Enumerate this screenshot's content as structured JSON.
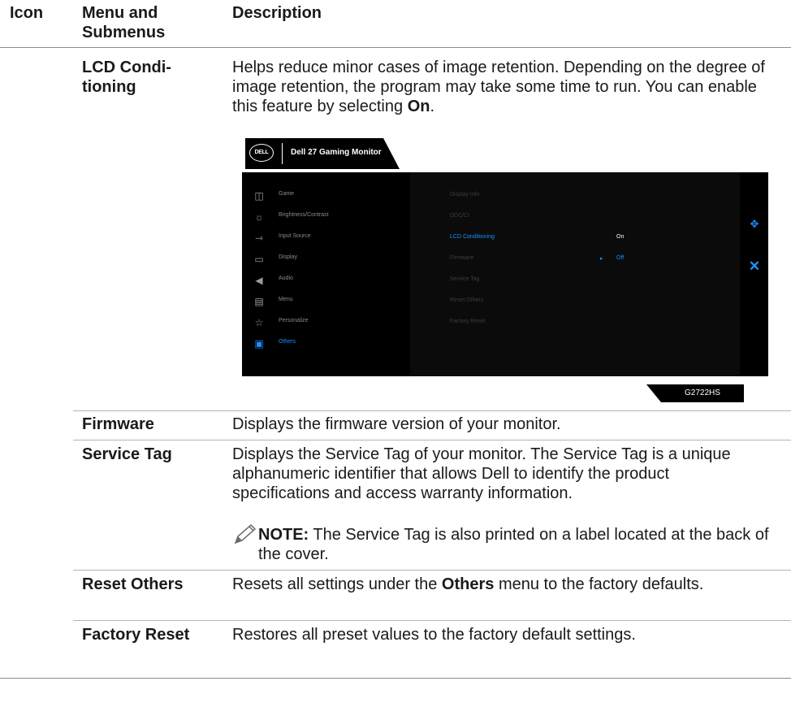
{
  "headers": {
    "icon": "Icon",
    "menu": "Menu and Submenus",
    "description": "Description"
  },
  "rows": {
    "lcd": {
      "term": "LCD Condi-tioning",
      "desc_text": "Helps reduce minor cases of image retention. Depending on the degree of image retention, the program may take some time to run. You can enable this feature by selecting ",
      "desc_bold": "On",
      "desc_end": "."
    },
    "firmware": {
      "term": "Firmware",
      "desc": "Displays the firmware version of your monitor."
    },
    "service_tag": {
      "term": "Service Tag",
      "desc": "Displays the Service Tag of your monitor. The Service Tag is a unique alphanumeric identifier that allows Dell to identify the product specifications and access warranty information.",
      "note_label": "NOTE:",
      "note_text": " The Service Tag is also printed on a label located at the back of the cover."
    },
    "reset_others": {
      "term": "Reset Others",
      "desc_start": "Resets all settings under the ",
      "desc_bold": "Others",
      "desc_end": " menu to the factory defaults."
    },
    "factory_reset": {
      "term": "Factory Reset",
      "desc": "Restores all preset values to the factory default settings."
    }
  },
  "osd": {
    "logo": "DELL",
    "title": "Dell 27 Gaming Monitor",
    "menu_items": [
      {
        "label": "Game",
        "icon": "game-icon"
      },
      {
        "label": "Brightness/Contrast",
        "icon": "brightness-icon"
      },
      {
        "label": "Input Source",
        "icon": "input-source-icon"
      },
      {
        "label": "Display",
        "icon": "display-icon"
      },
      {
        "label": "Audio",
        "icon": "audio-icon"
      },
      {
        "label": "Menu",
        "icon": "menu-icon"
      },
      {
        "label": "Personalize",
        "icon": "star-icon"
      },
      {
        "label": "Others",
        "icon": "others-icon"
      }
    ],
    "active_menu": "Others",
    "submenu": [
      "Display Info",
      "DDC/CI",
      "LCD Conditioning",
      "Firmware",
      "Service Tag",
      "Reset Others",
      "Factory Reset"
    ],
    "active_submenu": "LCD Conditioning",
    "value_on": "On",
    "value_off": "Off",
    "model": "G2722HS",
    "accent_color": "#1e90ff"
  }
}
